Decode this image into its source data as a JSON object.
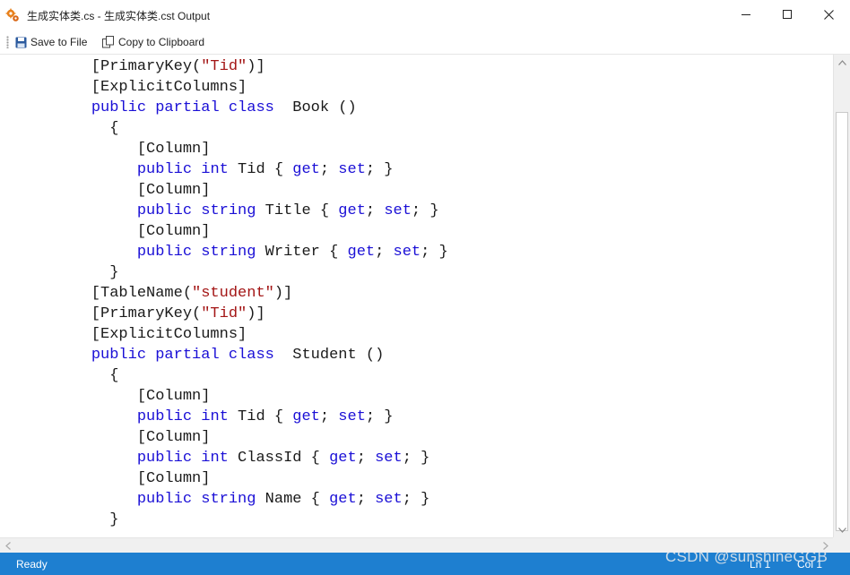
{
  "window": {
    "title": "生成实体类.cs - 生成实体类.cst Output",
    "app_icon": "gear-cluster-icon",
    "controls": {
      "minimize_icon": "minimize-icon",
      "maximize_icon": "maximize-icon",
      "close_icon": "close-icon"
    }
  },
  "toolbar": {
    "save_label": "Save to File",
    "save_icon": "floppy-disk-icon",
    "copy_label": "Copy to Clipboard",
    "copy_icon": "copy-icon"
  },
  "editor": {
    "lines": [
      [
        {
          "t": "    [PrimaryKey(",
          "c": "p"
        },
        {
          "t": "\"Tid\"",
          "c": "s"
        },
        {
          "t": ")]",
          "c": "p"
        }
      ],
      [
        {
          "t": "    [ExplicitColumns]",
          "c": "p"
        }
      ],
      [
        {
          "t": "    ",
          "c": "p"
        },
        {
          "t": "public",
          "c": "k"
        },
        {
          "t": " ",
          "c": "p"
        },
        {
          "t": "partial",
          "c": "k"
        },
        {
          "t": " ",
          "c": "p"
        },
        {
          "t": "class",
          "c": "k"
        },
        {
          "t": "  Book ()",
          "c": "p"
        }
      ],
      [
        {
          "t": "      {",
          "c": "p"
        }
      ],
      [
        {
          "t": "         [Column]",
          "c": "p"
        }
      ],
      [
        {
          "t": "         ",
          "c": "p"
        },
        {
          "t": "public",
          "c": "k"
        },
        {
          "t": " ",
          "c": "p"
        },
        {
          "t": "int",
          "c": "k"
        },
        {
          "t": " Tid { ",
          "c": "p"
        },
        {
          "t": "get",
          "c": "k"
        },
        {
          "t": "; ",
          "c": "p"
        },
        {
          "t": "set",
          "c": "k"
        },
        {
          "t": "; }",
          "c": "p"
        }
      ],
      [
        {
          "t": "         [Column]",
          "c": "p"
        }
      ],
      [
        {
          "t": "         ",
          "c": "p"
        },
        {
          "t": "public",
          "c": "k"
        },
        {
          "t": " ",
          "c": "p"
        },
        {
          "t": "string",
          "c": "k"
        },
        {
          "t": " Title { ",
          "c": "p"
        },
        {
          "t": "get",
          "c": "k"
        },
        {
          "t": "; ",
          "c": "p"
        },
        {
          "t": "set",
          "c": "k"
        },
        {
          "t": "; }",
          "c": "p"
        }
      ],
      [
        {
          "t": "         [Column]",
          "c": "p"
        }
      ],
      [
        {
          "t": "         ",
          "c": "p"
        },
        {
          "t": "public",
          "c": "k"
        },
        {
          "t": " ",
          "c": "p"
        },
        {
          "t": "string",
          "c": "k"
        },
        {
          "t": " Writer { ",
          "c": "p"
        },
        {
          "t": "get",
          "c": "k"
        },
        {
          "t": "; ",
          "c": "p"
        },
        {
          "t": "set",
          "c": "k"
        },
        {
          "t": "; }",
          "c": "p"
        }
      ],
      [
        {
          "t": "      }",
          "c": "p"
        }
      ],
      [
        {
          "t": "    [TableName(",
          "c": "p"
        },
        {
          "t": "\"student\"",
          "c": "s"
        },
        {
          "t": ")]",
          "c": "p"
        }
      ],
      [
        {
          "t": "    [PrimaryKey(",
          "c": "p"
        },
        {
          "t": "\"Tid\"",
          "c": "s"
        },
        {
          "t": ")]",
          "c": "p"
        }
      ],
      [
        {
          "t": "    [ExplicitColumns]",
          "c": "p"
        }
      ],
      [
        {
          "t": "    ",
          "c": "p"
        },
        {
          "t": "public",
          "c": "k"
        },
        {
          "t": " ",
          "c": "p"
        },
        {
          "t": "partial",
          "c": "k"
        },
        {
          "t": " ",
          "c": "p"
        },
        {
          "t": "class",
          "c": "k"
        },
        {
          "t": "  Student ()",
          "c": "p"
        }
      ],
      [
        {
          "t": "      {",
          "c": "p"
        }
      ],
      [
        {
          "t": "         [Column]",
          "c": "p"
        }
      ],
      [
        {
          "t": "         ",
          "c": "p"
        },
        {
          "t": "public",
          "c": "k"
        },
        {
          "t": " ",
          "c": "p"
        },
        {
          "t": "int",
          "c": "k"
        },
        {
          "t": " Tid { ",
          "c": "p"
        },
        {
          "t": "get",
          "c": "k"
        },
        {
          "t": "; ",
          "c": "p"
        },
        {
          "t": "set",
          "c": "k"
        },
        {
          "t": "; }",
          "c": "p"
        }
      ],
      [
        {
          "t": "         [Column]",
          "c": "p"
        }
      ],
      [
        {
          "t": "         ",
          "c": "p"
        },
        {
          "t": "public",
          "c": "k"
        },
        {
          "t": " ",
          "c": "p"
        },
        {
          "t": "int",
          "c": "k"
        },
        {
          "t": " ClassId { ",
          "c": "p"
        },
        {
          "t": "get",
          "c": "k"
        },
        {
          "t": "; ",
          "c": "p"
        },
        {
          "t": "set",
          "c": "k"
        },
        {
          "t": "; }",
          "c": "p"
        }
      ],
      [
        {
          "t": "         [Column]",
          "c": "p"
        }
      ],
      [
        {
          "t": "         ",
          "c": "p"
        },
        {
          "t": "public",
          "c": "k"
        },
        {
          "t": " ",
          "c": "p"
        },
        {
          "t": "string",
          "c": "k"
        },
        {
          "t": " Name { ",
          "c": "p"
        },
        {
          "t": "get",
          "c": "k"
        },
        {
          "t": "; ",
          "c": "p"
        },
        {
          "t": "set",
          "c": "k"
        },
        {
          "t": "; }",
          "c": "p"
        }
      ],
      [
        {
          "t": "      }",
          "c": "p"
        }
      ]
    ],
    "colors": {
      "keyword": "#1a0fd6",
      "string": "#a31515",
      "plain": "#1a1a1a"
    }
  },
  "scrollbars": {
    "vertical": {
      "up_icon": "arrow-up-icon",
      "down_icon": "arrow-down-icon"
    },
    "horizontal": {
      "left_icon": "arrow-left-icon",
      "right_icon": "arrow-right-icon"
    }
  },
  "status": {
    "state": "Ready",
    "line": "Ln 1",
    "col": "Col 1",
    "background": "#1e7fd0"
  },
  "watermark": "CSDN @sunshineGGB"
}
